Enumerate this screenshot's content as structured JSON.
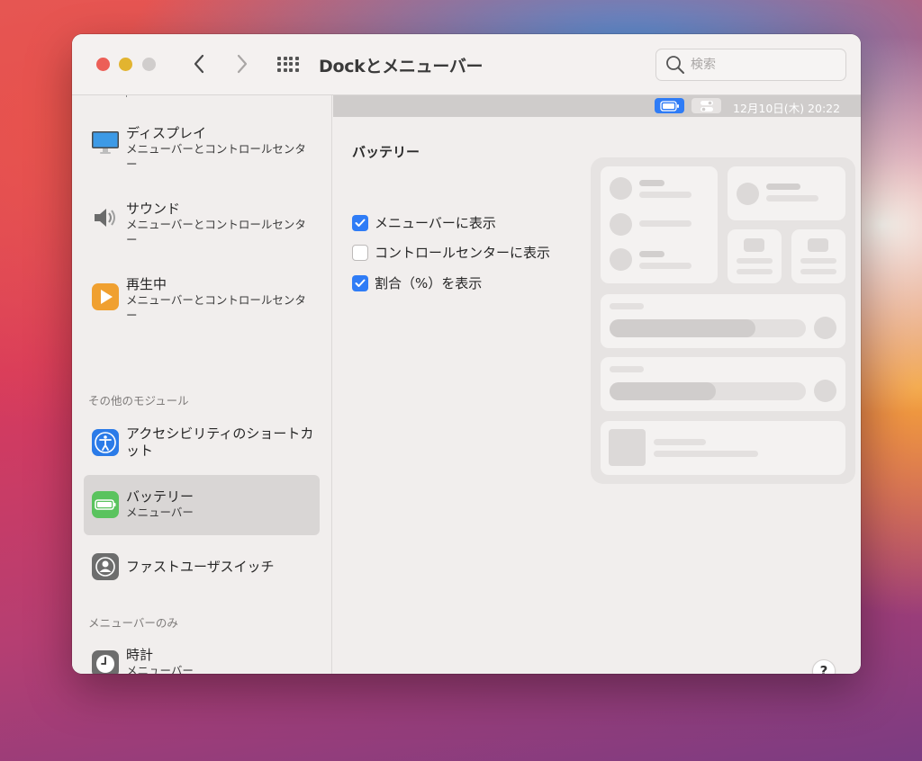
{
  "window": {
    "title": "Dockとメニューバー"
  },
  "search": {
    "placeholder": "検索"
  },
  "sidebar": {
    "items": [
      {
        "title": "ディスプレイ",
        "subtitle": "メニューバーとコントロールセンター",
        "icon": "display-icon"
      },
      {
        "title": "サウンド",
        "subtitle": "メニューバーとコントロールセンター",
        "icon": "speaker-icon"
      },
      {
        "title": "再生中",
        "subtitle": "メニューバーとコントロールセンター",
        "icon": "play-icon"
      }
    ],
    "section_other": "その他のモジュール",
    "other_items": [
      {
        "title": "アクセシビリティのショートカット",
        "icon": "accessibility-icon"
      },
      {
        "title": "バッテリー",
        "subtitle": "メニューバー",
        "icon": "battery-icon",
        "selected": true
      },
      {
        "title": "ファストユーザスイッチ",
        "icon": "user-switch-icon"
      }
    ],
    "section_menubar_only": "メニューバーのみ",
    "menubar_items": [
      {
        "title": "時計",
        "subtitle": "メニューバー",
        "icon": "clock-icon"
      }
    ]
  },
  "menubar_preview": {
    "clock": "12月10日(木)  20:22"
  },
  "pane": {
    "heading": "バッテリー",
    "options": [
      {
        "label": "メニューバーに表示",
        "checked": true
      },
      {
        "label": "コントロールセンターに表示",
        "checked": false
      },
      {
        "label": "割合（%）を表示",
        "checked": true
      }
    ]
  },
  "help": {
    "label": "?"
  },
  "colors": {
    "accent": "#2f7cf6",
    "selected_row": "#d9d6d5"
  }
}
